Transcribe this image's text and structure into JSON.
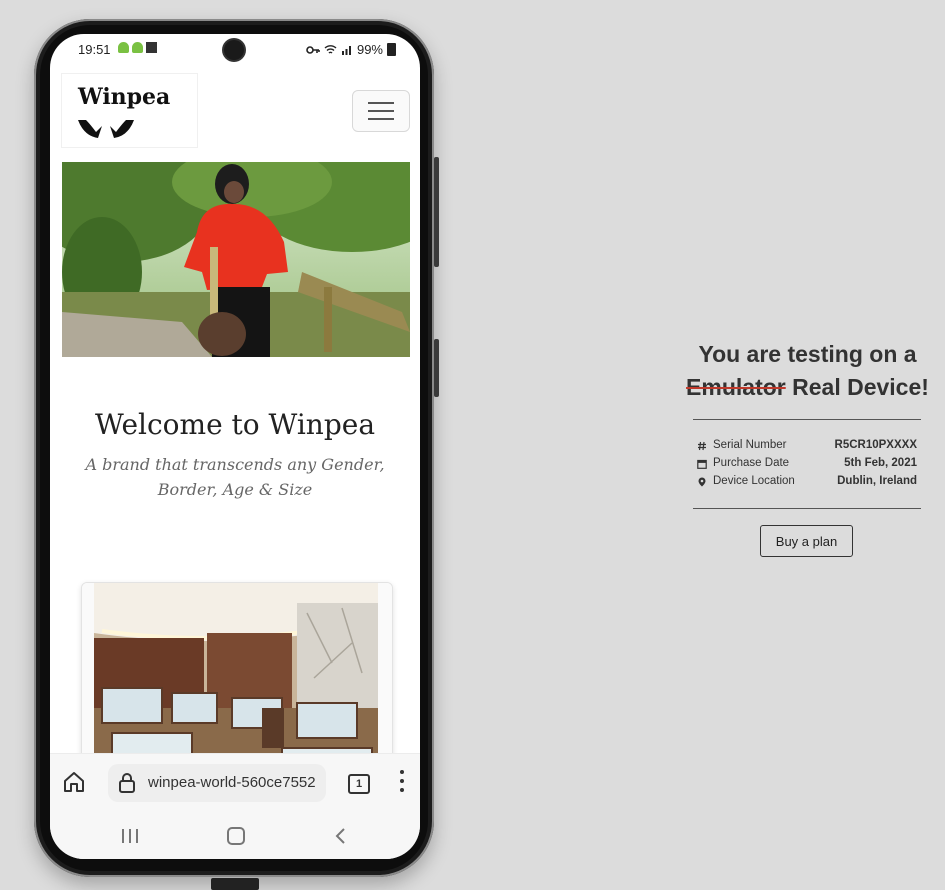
{
  "status_bar": {
    "time": "19:51",
    "battery": "99%",
    "icons": [
      "android-icon",
      "android-icon",
      "notification-square-icon",
      "key-icon",
      "wifi-icon",
      "signal-icon",
      "battery-icon"
    ]
  },
  "website": {
    "logo_text": "Winpea",
    "welcome": "Welcome to Winpea",
    "tagline": "A brand that transcends any Gender, Border, Age & Size"
  },
  "browser": {
    "url": "winpea-world-560ce7552",
    "tab_count": "1"
  },
  "info": {
    "headline_prefix": "You are testing on a",
    "struck_word": "Emulator",
    "headline_suffix": "Real Device!",
    "specs": [
      {
        "icon": "hash-icon",
        "label": "Serial Number",
        "value": "R5CR10PXXXX"
      },
      {
        "icon": "calendar-icon",
        "label": "Purchase Date",
        "value": "5th Feb, 2021"
      },
      {
        "icon": "location-pin-icon",
        "label": "Device Location",
        "value": "Dublin, Ireland"
      }
    ],
    "buy_label": "Buy a plan"
  },
  "colors": {
    "background": "#dcdcdc",
    "strike": "#c0392b",
    "sweater_red": "#e8321f",
    "android_green": "#7ac142"
  }
}
